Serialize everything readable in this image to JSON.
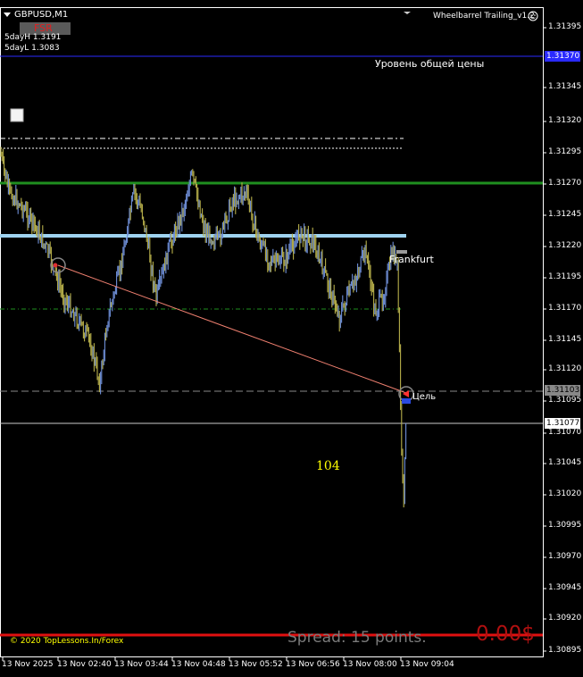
{
  "header": {
    "symbol": "GBPUSD,M1",
    "indicator_name": "Wheelbarrel Trailing_v1.2",
    "fsr_label": "FSR",
    "day_high": "5dayH 1.3191",
    "day_low": "5dayL 1.3083"
  },
  "annotations": {
    "general_price_level": "Уровень общей цены",
    "frankfurt": "Frankfurt",
    "target": "Цель",
    "count": "104",
    "copyright": "© 2020 TopLessons.In/Forex",
    "spread": "Spread: 15 points.",
    "profit": "0.00$"
  },
  "price_axis": {
    "ticks": [
      "1.31395",
      "1.31345",
      "1.31320",
      "1.31295",
      "1.31270",
      "1.31245",
      "1.31220",
      "1.31195",
      "1.31170",
      "1.31145",
      "1.31120",
      "1.31095",
      "1.31070",
      "1.31045",
      "1.31020",
      "1.30995",
      "1.30970",
      "1.30945",
      "1.30920",
      "1.30895"
    ],
    "badges": {
      "blue_level": "1.31370",
      "target_level": "1.31103",
      "current_price": "1.31077"
    }
  },
  "time_axis": {
    "labels": [
      "13 Nov 2025",
      "13 Nov 02:40",
      "13 Nov 03:44",
      "13 Nov 04:48",
      "13 Nov 05:52",
      "13 Nov 06:56",
      "13 Nov 08:00",
      "13 Nov 09:04"
    ]
  },
  "colors": {
    "background": "#000000",
    "bull_bar": "#6f8fd8",
    "bear_bar": "#b8b04a",
    "green_level": "#1f8f1f",
    "lightblue_level": "#9fd3f0",
    "blue_level": "#2a2aff",
    "red_level": "#e01010",
    "trendline": "#f08070",
    "count_text": "#ffff00",
    "profit_text": "#b01010",
    "spread_text": "#7a7a7a"
  },
  "chart_data": {
    "type": "bar",
    "title": "GBPUSD,M1",
    "price_levels": [
      {
        "name": "green",
        "price": 1.3127
      },
      {
        "name": "lightblue",
        "price": 1.31228
      },
      {
        "name": "blue",
        "price": 1.3137
      },
      {
        "name": "target",
        "price": 1.31103
      },
      {
        "name": "current",
        "price": 1.31077
      }
    ],
    "ylim": [
      1.3088,
      1.3143
    ]
  }
}
